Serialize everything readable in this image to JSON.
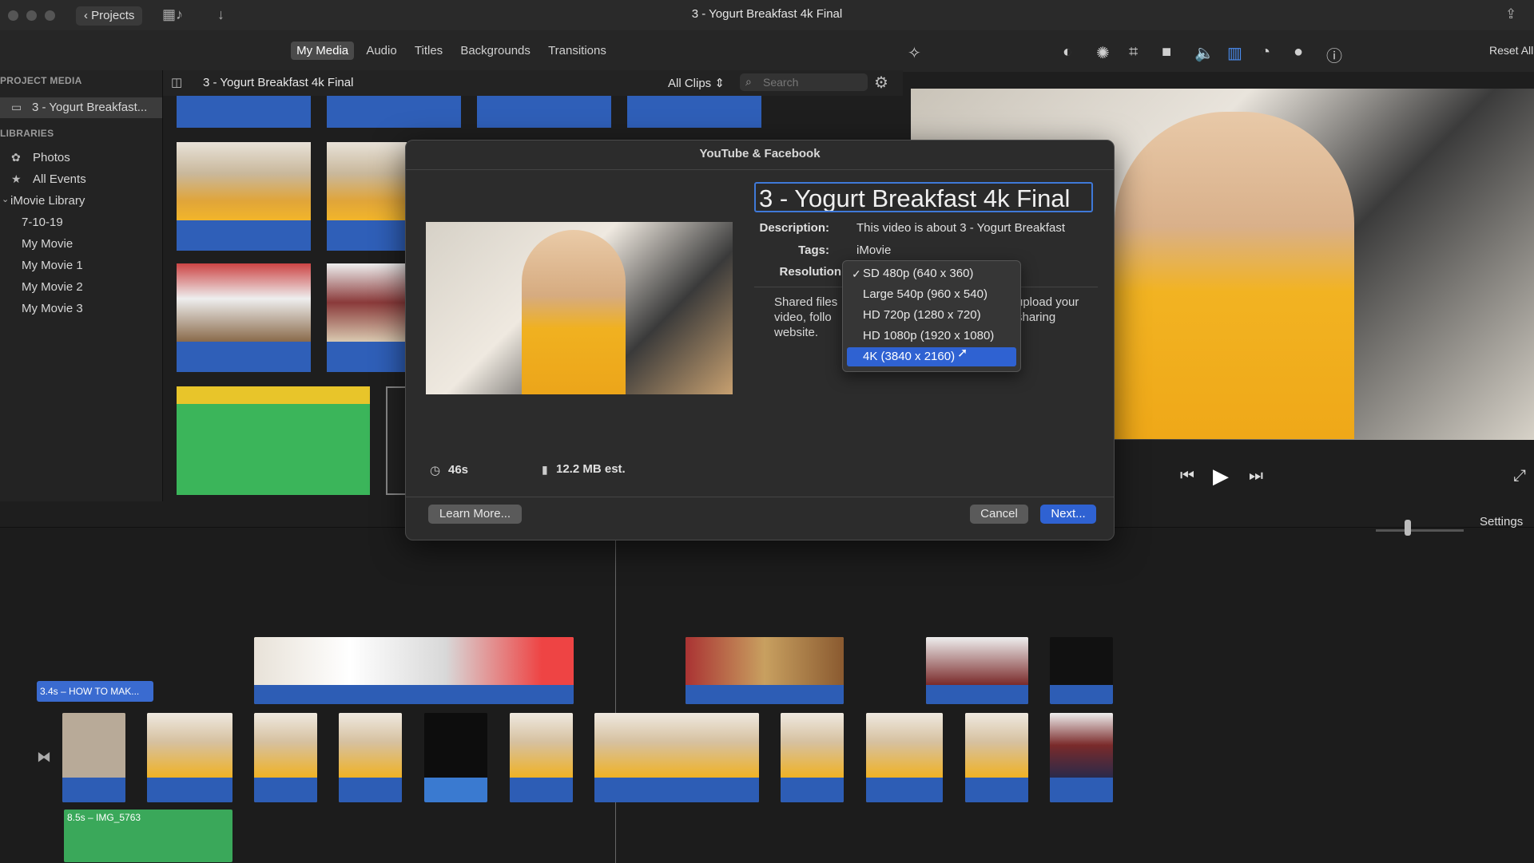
{
  "window": {
    "title": "3 - Yogurt Breakfast 4k Final",
    "back_button": "Projects"
  },
  "media_tabs": [
    "My Media",
    "Audio",
    "Titles",
    "Backgrounds",
    "Transitions"
  ],
  "right_toolbar": {
    "reset_all": "Reset All"
  },
  "sidebar": {
    "project_media_header": "PROJECT MEDIA",
    "project_item": "3 - Yogurt Breakfast...",
    "libraries_header": "LIBRARIES",
    "items": [
      "Photos",
      "All Events"
    ],
    "library": "iMovie Library",
    "library_items": [
      "7-10-19",
      "My Movie",
      "My Movie 1",
      "My Movie 2",
      "My Movie 3"
    ]
  },
  "browser": {
    "title": "3 - Yogurt Breakfast 4k Final",
    "filter": "All Clips",
    "search_placeholder": "Search"
  },
  "viewer": {
    "settings_label": "Settings"
  },
  "dialog": {
    "title": "YouTube & Facebook",
    "name_value": "3 - Yogurt Breakfast 4k Final",
    "description_label": "Description:",
    "description_value": "This video is about 3 - Yogurt Breakfast",
    "tags_label": "Tags:",
    "tags_value": "iMovie",
    "resolution_label": "Resolution",
    "note_left": "Shared files\nvideo, follo\nwebsite.",
    "note_right": "upload your\nsharing",
    "duration": "46s",
    "size": "12.2 MB est.",
    "learn_more": "Learn More...",
    "cancel": "Cancel",
    "next": "Next...",
    "resolution_options": [
      {
        "label": "SD 480p (640 x 360)",
        "checked": true
      },
      {
        "label": "Large 540p (960 x 540)"
      },
      {
        "label": "HD 720p (1280 x 720)"
      },
      {
        "label": "HD 1080p (1920 x 1080)"
      },
      {
        "label": "4K (3840 x 2160)",
        "highlighted": true
      }
    ]
  },
  "timeline": {
    "title_clip": "3.4s – HOW TO MAK...",
    "audio_clip": "8.5s – IMG_5763"
  }
}
